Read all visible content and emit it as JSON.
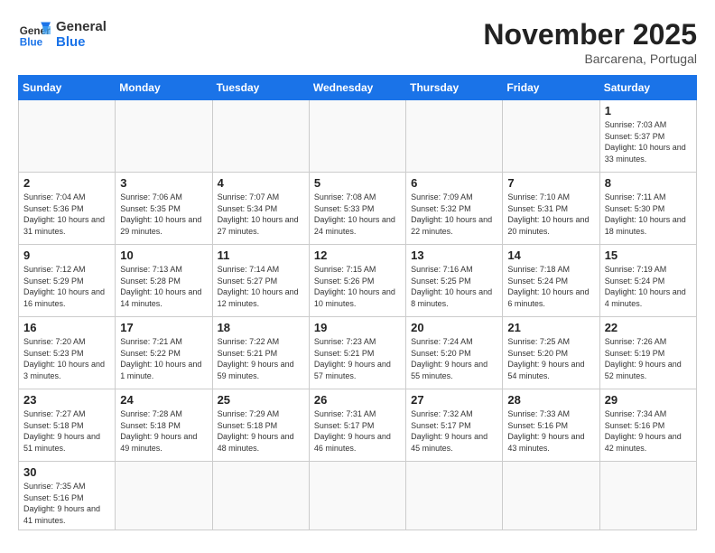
{
  "header": {
    "logo_general": "General",
    "logo_blue": "Blue",
    "month": "November 2025",
    "location": "Barcarena, Portugal"
  },
  "days_of_week": [
    "Sunday",
    "Monday",
    "Tuesday",
    "Wednesday",
    "Thursday",
    "Friday",
    "Saturday"
  ],
  "weeks": [
    [
      {
        "day": "",
        "info": ""
      },
      {
        "day": "",
        "info": ""
      },
      {
        "day": "",
        "info": ""
      },
      {
        "day": "",
        "info": ""
      },
      {
        "day": "",
        "info": ""
      },
      {
        "day": "",
        "info": ""
      },
      {
        "day": "1",
        "info": "Sunrise: 7:03 AM\nSunset: 5:37 PM\nDaylight: 10 hours and 33 minutes."
      }
    ],
    [
      {
        "day": "2",
        "info": "Sunrise: 7:04 AM\nSunset: 5:36 PM\nDaylight: 10 hours and 31 minutes."
      },
      {
        "day": "3",
        "info": "Sunrise: 7:06 AM\nSunset: 5:35 PM\nDaylight: 10 hours and 29 minutes."
      },
      {
        "day": "4",
        "info": "Sunrise: 7:07 AM\nSunset: 5:34 PM\nDaylight: 10 hours and 27 minutes."
      },
      {
        "day": "5",
        "info": "Sunrise: 7:08 AM\nSunset: 5:33 PM\nDaylight: 10 hours and 24 minutes."
      },
      {
        "day": "6",
        "info": "Sunrise: 7:09 AM\nSunset: 5:32 PM\nDaylight: 10 hours and 22 minutes."
      },
      {
        "day": "7",
        "info": "Sunrise: 7:10 AM\nSunset: 5:31 PM\nDaylight: 10 hours and 20 minutes."
      },
      {
        "day": "8",
        "info": "Sunrise: 7:11 AM\nSunset: 5:30 PM\nDaylight: 10 hours and 18 minutes."
      }
    ],
    [
      {
        "day": "9",
        "info": "Sunrise: 7:12 AM\nSunset: 5:29 PM\nDaylight: 10 hours and 16 minutes."
      },
      {
        "day": "10",
        "info": "Sunrise: 7:13 AM\nSunset: 5:28 PM\nDaylight: 10 hours and 14 minutes."
      },
      {
        "day": "11",
        "info": "Sunrise: 7:14 AM\nSunset: 5:27 PM\nDaylight: 10 hours and 12 minutes."
      },
      {
        "day": "12",
        "info": "Sunrise: 7:15 AM\nSunset: 5:26 PM\nDaylight: 10 hours and 10 minutes."
      },
      {
        "day": "13",
        "info": "Sunrise: 7:16 AM\nSunset: 5:25 PM\nDaylight: 10 hours and 8 minutes."
      },
      {
        "day": "14",
        "info": "Sunrise: 7:18 AM\nSunset: 5:24 PM\nDaylight: 10 hours and 6 minutes."
      },
      {
        "day": "15",
        "info": "Sunrise: 7:19 AM\nSunset: 5:24 PM\nDaylight: 10 hours and 4 minutes."
      }
    ],
    [
      {
        "day": "16",
        "info": "Sunrise: 7:20 AM\nSunset: 5:23 PM\nDaylight: 10 hours and 3 minutes."
      },
      {
        "day": "17",
        "info": "Sunrise: 7:21 AM\nSunset: 5:22 PM\nDaylight: 10 hours and 1 minute."
      },
      {
        "day": "18",
        "info": "Sunrise: 7:22 AM\nSunset: 5:21 PM\nDaylight: 9 hours and 59 minutes."
      },
      {
        "day": "19",
        "info": "Sunrise: 7:23 AM\nSunset: 5:21 PM\nDaylight: 9 hours and 57 minutes."
      },
      {
        "day": "20",
        "info": "Sunrise: 7:24 AM\nSunset: 5:20 PM\nDaylight: 9 hours and 55 minutes."
      },
      {
        "day": "21",
        "info": "Sunrise: 7:25 AM\nSunset: 5:20 PM\nDaylight: 9 hours and 54 minutes."
      },
      {
        "day": "22",
        "info": "Sunrise: 7:26 AM\nSunset: 5:19 PM\nDaylight: 9 hours and 52 minutes."
      }
    ],
    [
      {
        "day": "23",
        "info": "Sunrise: 7:27 AM\nSunset: 5:18 PM\nDaylight: 9 hours and 51 minutes."
      },
      {
        "day": "24",
        "info": "Sunrise: 7:28 AM\nSunset: 5:18 PM\nDaylight: 9 hours and 49 minutes."
      },
      {
        "day": "25",
        "info": "Sunrise: 7:29 AM\nSunset: 5:18 PM\nDaylight: 9 hours and 48 minutes."
      },
      {
        "day": "26",
        "info": "Sunrise: 7:31 AM\nSunset: 5:17 PM\nDaylight: 9 hours and 46 minutes."
      },
      {
        "day": "27",
        "info": "Sunrise: 7:32 AM\nSunset: 5:17 PM\nDaylight: 9 hours and 45 minutes."
      },
      {
        "day": "28",
        "info": "Sunrise: 7:33 AM\nSunset: 5:16 PM\nDaylight: 9 hours and 43 minutes."
      },
      {
        "day": "29",
        "info": "Sunrise: 7:34 AM\nSunset: 5:16 PM\nDaylight: 9 hours and 42 minutes."
      }
    ],
    [
      {
        "day": "30",
        "info": "Sunrise: 7:35 AM\nSunset: 5:16 PM\nDaylight: 9 hours and 41 minutes."
      },
      {
        "day": "",
        "info": ""
      },
      {
        "day": "",
        "info": ""
      },
      {
        "day": "",
        "info": ""
      },
      {
        "day": "",
        "info": ""
      },
      {
        "day": "",
        "info": ""
      },
      {
        "day": "",
        "info": ""
      }
    ]
  ]
}
